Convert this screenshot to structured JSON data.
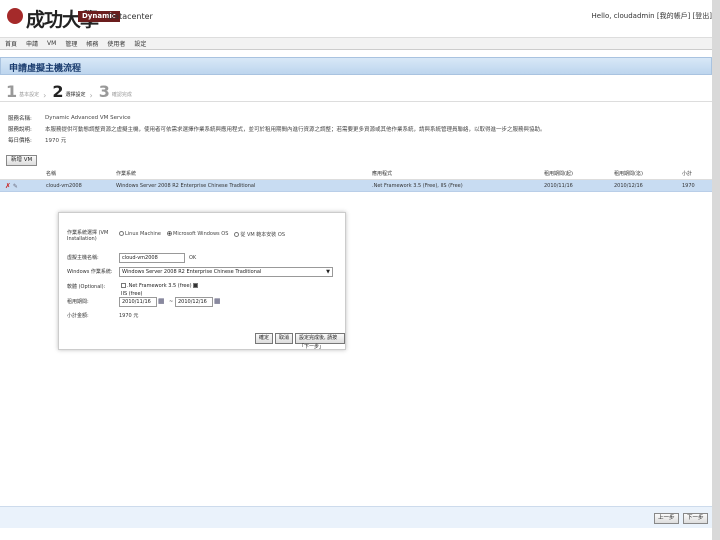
{
  "header": {
    "logo_text": "成功大學",
    "brand_box": "Dynamic",
    "brand_text": "Datacenter",
    "user_info": "Hello, cloudadmin  [我的帳戶] [登出]"
  },
  "menu": [
    "首頁",
    "申請",
    "VM",
    "管理",
    "帳務",
    "使用者",
    "設定"
  ],
  "page_title": "申請虛擬主機流程",
  "steps": [
    {
      "num": "1",
      "label": "基本設定"
    },
    {
      "num": "2",
      "label": "選擇設定"
    },
    {
      "num": "3",
      "label": "確認完成"
    }
  ],
  "info": [
    {
      "k": "服務名稱:",
      "v": "Dynamic Advanced VM Service"
    },
    {
      "k": "服務說明:",
      "v": "本服務提供可動態調整資源之虛擬主機，使用者可依需求選擇作業系統與應用程式，並可於租用期間內進行資源之調整；若需要更多資源或其他作業系統，請與系統管理員聯絡，以取得進一步之服務與協助。"
    },
    {
      "k": "每日價格:",
      "v": "1970 元"
    }
  ],
  "add_vm_label": "新增 VM",
  "table": {
    "headers": [
      "",
      "名稱",
      "作業系統",
      "應用程式",
      "租用期間(起)",
      "租用期間(迄)",
      "小計"
    ],
    "rows": [
      {
        "name": "cloud-vm2008",
        "os": "Windows Server 2008 R2 Enterprise Chinese Traditional",
        "app": ".Net Framework 3.5 (Free), IIS (Free)",
        "start": "2010/11/16",
        "end": "2010/12/16",
        "subtotal": "1970"
      }
    ]
  },
  "form": {
    "vm_type_label": "作業系統選擇 (VM Installation)",
    "radio_options": [
      "Linux Machine",
      "Microsoft Windows OS",
      "從 VM 範本安裝 OS"
    ],
    "vm_name_label": "虛擬主機名稱:",
    "vm_name_value": "cloud-vm2008",
    "vm_name_status": "OK",
    "windows_os_label": "Windows 作業系統:",
    "windows_os_value": "Windows Server 2008 R2 Enterprise Chinese Traditional",
    "software_label": "軟體 (Optional):",
    "software_options": [
      ".Net Framework 3.5 (free)",
      "IIS (free)"
    ],
    "period_label": "租用期間:",
    "start_date": "2010/11/16",
    "end_date": "2010/12/16",
    "subtotal_label": "小計金額:",
    "subtotal_value": "1970 元",
    "btn_confirm": "確定",
    "btn_cancel": "取消",
    "btn_more": "設定完成後, 請按「下一步」"
  },
  "nav": {
    "prev": "上一步",
    "next": "下一步"
  }
}
